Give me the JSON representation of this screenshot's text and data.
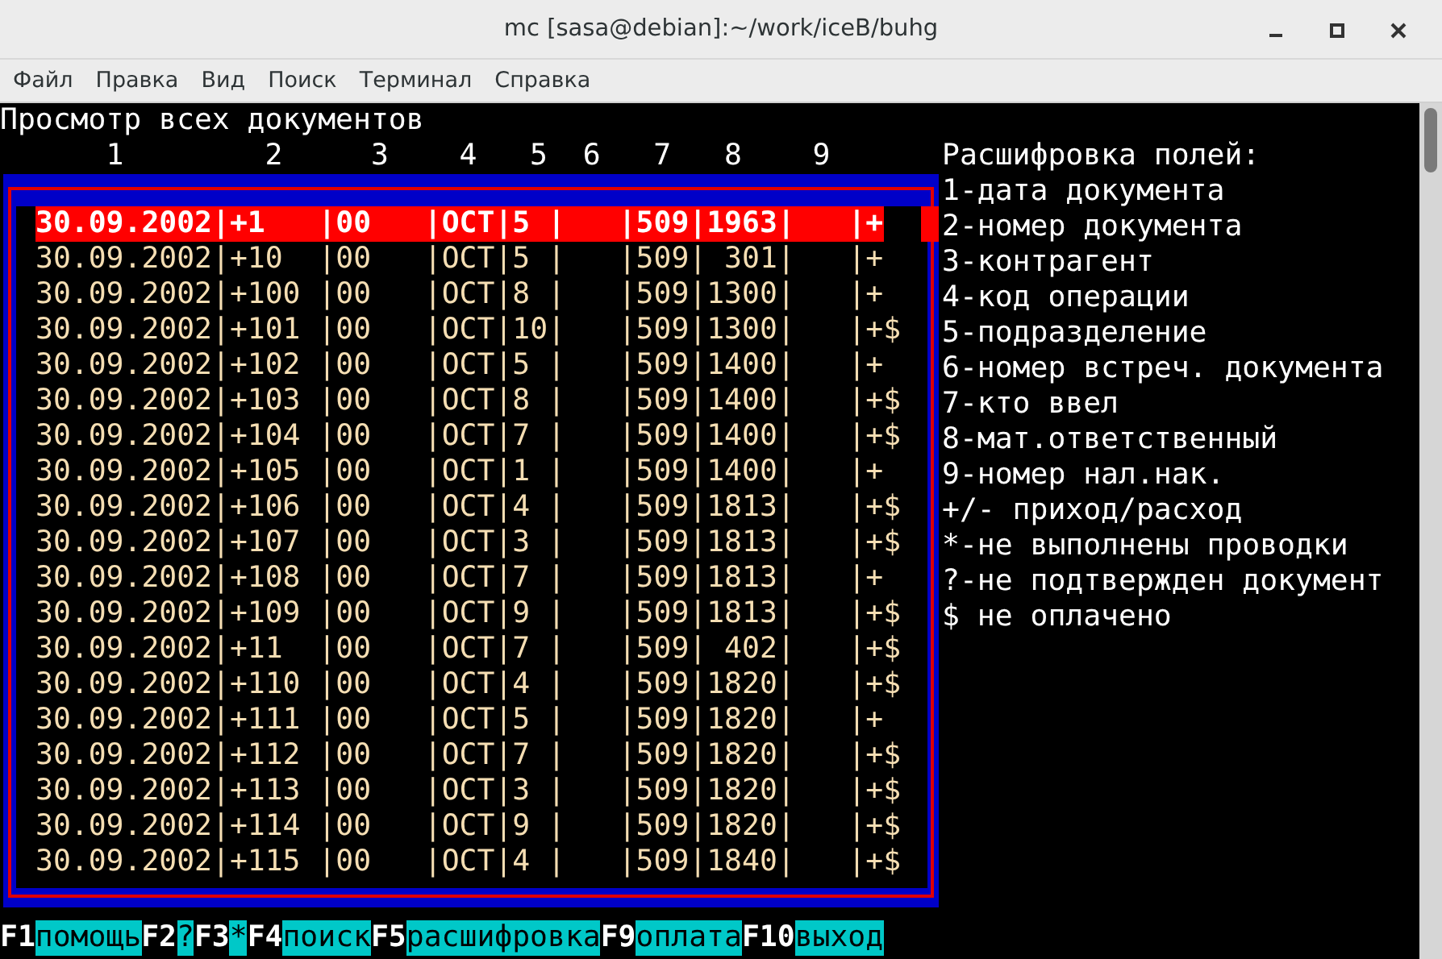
{
  "window": {
    "title": "mc [sasa@debian]:~/work/iceB/buhg"
  },
  "menu": [
    "Файл",
    "Правка",
    "Вид",
    "Поиск",
    "Терминал",
    "Справка"
  ],
  "heading": "Просмотр всех документов",
  "column_numbers": [
    "1",
    "2",
    "3",
    "4",
    "5",
    "6",
    "7",
    "8",
    "9"
  ],
  "rows": [
    {
      "text": "30.09.2002|+1   |00   |ОСТ|5 |   |509|1963|   |+",
      "selected": true
    },
    {
      "text": "30.09.2002|+10  |00   |ОСТ|5 |   |509| 301|   |+",
      "selected": false
    },
    {
      "text": "30.09.2002|+100 |00   |ОСТ|8 |   |509|1300|   |+",
      "selected": false
    },
    {
      "text": "30.09.2002|+101 |00   |ОСТ|10|   |509|1300|   |+$",
      "selected": false
    },
    {
      "text": "30.09.2002|+102 |00   |ОСТ|5 |   |509|1400|   |+",
      "selected": false
    },
    {
      "text": "30.09.2002|+103 |00   |ОСТ|8 |   |509|1400|   |+$",
      "selected": false
    },
    {
      "text": "30.09.2002|+104 |00   |ОСТ|7 |   |509|1400|   |+$",
      "selected": false
    },
    {
      "text": "30.09.2002|+105 |00   |ОСТ|1 |   |509|1400|   |+",
      "selected": false
    },
    {
      "text": "30.09.2002|+106 |00   |ОСТ|4 |   |509|1813|   |+$",
      "selected": false
    },
    {
      "text": "30.09.2002|+107 |00   |ОСТ|3 |   |509|1813|   |+$",
      "selected": false
    },
    {
      "text": "30.09.2002|+108 |00   |ОСТ|7 |   |509|1813|   |+",
      "selected": false
    },
    {
      "text": "30.09.2002|+109 |00   |ОСТ|9 |   |509|1813|   |+$",
      "selected": false
    },
    {
      "text": "30.09.2002|+11  |00   |ОСТ|7 |   |509| 402|   |+$",
      "selected": false
    },
    {
      "text": "30.09.2002|+110 |00   |ОСТ|4 |   |509|1820|   |+$",
      "selected": false
    },
    {
      "text": "30.09.2002|+111 |00   |ОСТ|5 |   |509|1820|   |+",
      "selected": false
    },
    {
      "text": "30.09.2002|+112 |00   |ОСТ|7 |   |509|1820|   |+$",
      "selected": false
    },
    {
      "text": "30.09.2002|+113 |00   |ОСТ|3 |   |509|1820|   |+$",
      "selected": false
    },
    {
      "text": "30.09.2002|+114 |00   |ОСТ|9 |   |509|1820|   |+$",
      "selected": false
    },
    {
      "text": "30.09.2002|+115 |00   |ОСТ|4 |   |509|1840|   |+$",
      "selected": false
    }
  ],
  "legend": {
    "title": "Расшифровка полей:",
    "lines": [
      "1-дата документа",
      "2-номер документа",
      "3-контрагент",
      "4-код операции",
      "5-подразделение",
      "6-номер встреч. документа",
      "7-кто ввел",
      "8-мат.ответственный",
      "9-номер нал.нак.",
      "+/- приход/расход",
      "*-не выполнены проводки",
      "?-не подтвержден документ",
      "$ не оплачено"
    ]
  },
  "function_keys": [
    {
      "key": "F1",
      "label": "помощь"
    },
    {
      "key": "F2",
      "label": "?"
    },
    {
      "key": "F3",
      "label": "*"
    },
    {
      "key": "F4",
      "label": "поиск"
    },
    {
      "key": "F5",
      "label": "расшифровка"
    },
    {
      "key": "F9",
      "label": "оплата"
    },
    {
      "key": "F10",
      "label": "выход"
    }
  ]
}
